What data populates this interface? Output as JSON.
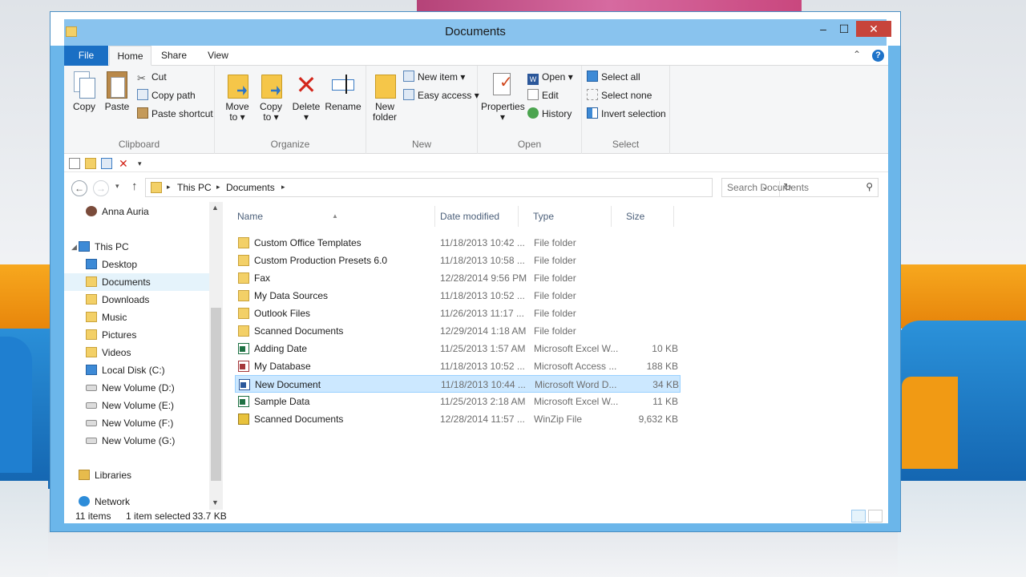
{
  "window": {
    "title": "Documents",
    "controls": {
      "minimize": "‒",
      "maximize": "☐",
      "close": "✕"
    }
  },
  "ribbon_tabs": {
    "file": "File",
    "home": "Home",
    "share": "Share",
    "view": "View"
  },
  "ribbon": {
    "clipboard": {
      "label": "Clipboard",
      "copy": "Copy",
      "paste": "Paste",
      "cut": "Cut",
      "copy_path": "Copy path",
      "paste_shortcut": "Paste shortcut"
    },
    "organize": {
      "label": "Organize",
      "move_to_1": "Move",
      "move_to_2": "to ▾",
      "copy_to_1": "Copy",
      "copy_to_2": "to ▾",
      "delete": "Delete",
      "delete_arrow": "▾",
      "rename": "Rename"
    },
    "new": {
      "label": "New",
      "new_folder_1": "New",
      "new_folder_2": "folder",
      "new_item": "New item ▾",
      "easy_access": "Easy access ▾"
    },
    "open": {
      "label": "Open",
      "properties": "Properties",
      "properties_arrow": "▾",
      "open": "Open ▾",
      "edit": "Edit",
      "history": "History"
    },
    "select": {
      "label": "Select",
      "select_all": "Select all",
      "select_none": "Select none",
      "invert_selection": "Invert selection"
    }
  },
  "address": {
    "crumbs": [
      "This PC",
      "Documents"
    ],
    "search_placeholder": "Search Documents"
  },
  "navigation": {
    "user": "Anna Auria",
    "this_pc": "This PC",
    "items": [
      "Desktop",
      "Documents",
      "Downloads",
      "Music",
      "Pictures",
      "Videos",
      "Local Disk (C:)",
      "New Volume (D:)",
      "New Volume (E:)",
      "New Volume (F:)",
      "New Volume (G:)"
    ],
    "libraries": "Libraries",
    "network": "Network"
  },
  "columns": {
    "name": "Name",
    "date_modified": "Date modified",
    "type": "Type",
    "size": "Size"
  },
  "files": [
    {
      "name": "Custom Office Templates",
      "date": "11/18/2013 10:42 ...",
      "type": "File folder",
      "size": "",
      "icon": "folder-icon"
    },
    {
      "name": "Custom Production Presets 6.0",
      "date": "11/18/2013 10:58 ...",
      "type": "File folder",
      "size": "",
      "icon": "folder-icon"
    },
    {
      "name": "Fax",
      "date": "12/28/2014 9:56 PM",
      "type": "File folder",
      "size": "",
      "icon": "folder-icon"
    },
    {
      "name": "My Data Sources",
      "date": "11/18/2013 10:52 ...",
      "type": "File folder",
      "size": "",
      "icon": "data-sources-folder-icon"
    },
    {
      "name": "Outlook Files",
      "date": "11/26/2013 11:17 ...",
      "type": "File folder",
      "size": "",
      "icon": "folder-icon"
    },
    {
      "name": "Scanned Documents",
      "date": "12/29/2014 1:18 AM",
      "type": "File folder",
      "size": "",
      "icon": "folder-icon"
    },
    {
      "name": "Adding Date",
      "date": "11/25/2013 1:57 AM",
      "type": "Microsoft Excel W...",
      "size": "10 KB",
      "icon": "excel-file-icon"
    },
    {
      "name": "My Database",
      "date": "11/18/2013 10:52 ...",
      "type": "Microsoft Access ...",
      "size": "188 KB",
      "icon": "access-file-icon"
    },
    {
      "name": "New Document",
      "date": "11/18/2013 10:44 ...",
      "type": "Microsoft Word D...",
      "size": "34 KB",
      "icon": "word-file-icon",
      "selected": true
    },
    {
      "name": "Sample Data",
      "date": "11/25/2013 2:18 AM",
      "type": "Microsoft Excel W...",
      "size": "11 KB",
      "icon": "excel-file-icon"
    },
    {
      "name": "Scanned Documents",
      "date": "12/28/2014 11:57 ...",
      "type": "WinZip File",
      "size": "9,632 KB",
      "icon": "zip-file-icon"
    }
  ],
  "status": {
    "item_count": "11 items",
    "selection": "1 item selected",
    "selection_size": "33.7 KB"
  },
  "colors": {
    "file_tab": "#1a6fc4",
    "selection": "#cce8ff",
    "close_button": "#c7443b",
    "window_frame": "#89c3ee"
  }
}
